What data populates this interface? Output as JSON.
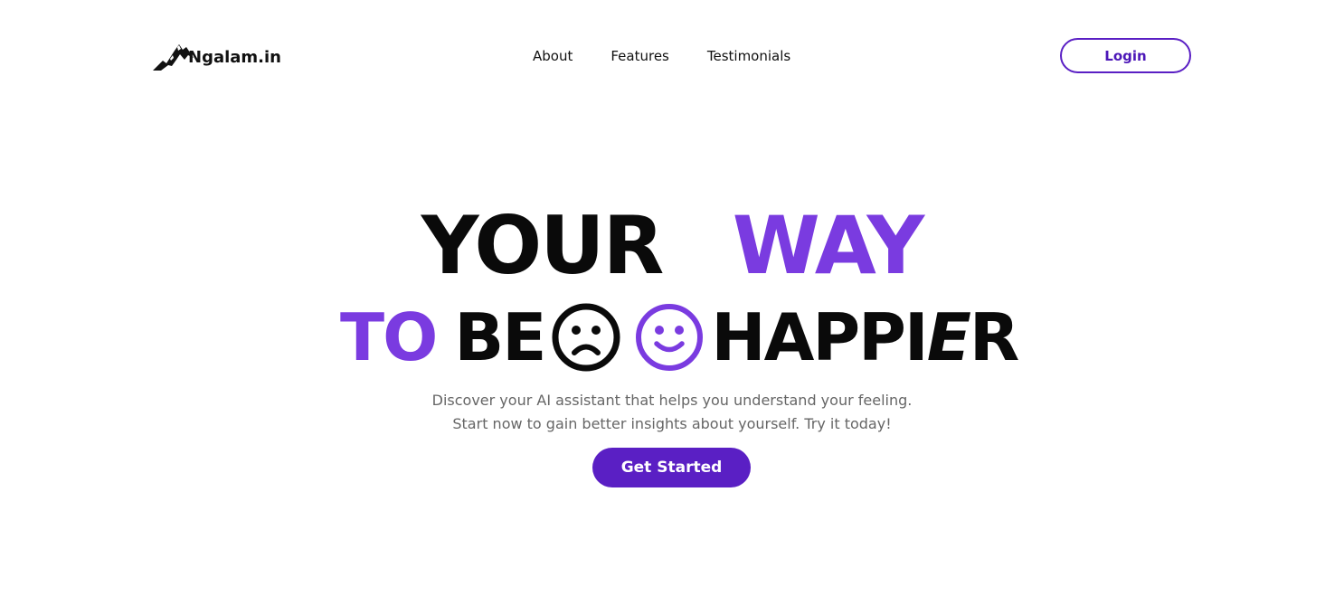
{
  "header": {
    "logo_text": "Ngalam.in",
    "nav": [
      {
        "label": "About"
      },
      {
        "label": "Features"
      },
      {
        "label": "Testimonials"
      }
    ],
    "login_label": "Login"
  },
  "hero": {
    "line1": {
      "part1": "YOUR",
      "part2": "WAY"
    },
    "line2": {
      "part1": "TO",
      "part2": "BE",
      "part3": "HAPPI",
      "part4": "E",
      "part5": "R"
    },
    "emojis": [
      "sad-face-icon",
      "smiley-face-icon"
    ],
    "subtext_line1": "Discover your AI assistant that helps you  understand your feeling.",
    "subtext_line2": "Start now to gain better insights about yourself. Try it today!",
    "cta_label": "Get Started"
  },
  "colors": {
    "accent": "#5a1fc4",
    "headline_purple": "#7a3be0",
    "text_dark": "#0a0a0a",
    "subtext": "#666666"
  }
}
